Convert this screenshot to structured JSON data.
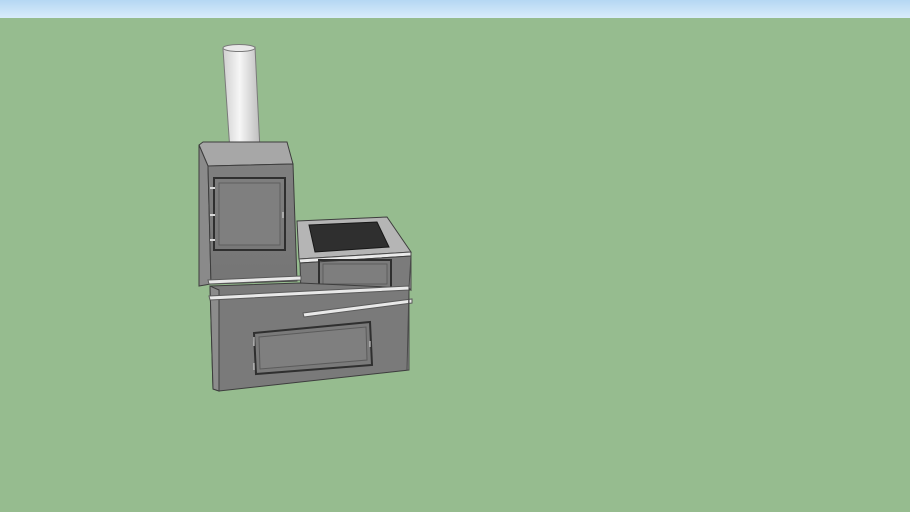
{
  "viewport": {
    "sky_top_color": "#b5d7f3",
    "sky_bottom_color": "#d9ecfb",
    "ground_color": "#96bc8f"
  },
  "model": {
    "object": "wood-stove",
    "colors": {
      "body_front": "#7b7b7b",
      "body_side": "#8b8b8b",
      "top_face": "#a6a6a6",
      "pipe_light": "#f3f3f3",
      "pipe_shadow": "#bdbdbd",
      "door_frame": "#2f2f2f",
      "trim": "#e6e6e6",
      "cooktop": "#2f2f2f"
    }
  }
}
